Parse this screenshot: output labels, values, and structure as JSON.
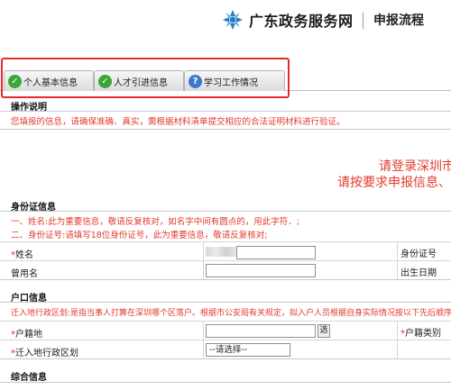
{
  "header": {
    "brand": "广东政务服务网",
    "link": "申报流程"
  },
  "tabs": [
    {
      "label": "个人基本信息",
      "status": "ok"
    },
    {
      "label": "人才引进信息",
      "status": "ok"
    },
    {
      "label": "学习工作情况",
      "status": "question"
    }
  ],
  "instructions": {
    "title": "操作说明",
    "text": "您填报的信息，请确保准确、真实，需根据材料清单提交相应的合法证明材料进行验证。"
  },
  "notice": {
    "line1": "请登录深圳市",
    "line2": "请按要求申报信息、准"
  },
  "id_section": {
    "title": "身份证信息",
    "note1": "一、姓名:此为重要信息，敬请反复核对，如名字中间有圆点的，用此字符．;",
    "note2": "二、身份证号:请填写18位身份证号，此为重要信息，敬请反复核对;",
    "name_label": "姓名",
    "used_name_label": "曾用名",
    "id_no_label": "身份证号",
    "birth_label": "出生日期"
  },
  "hukou_section": {
    "title": "户口信息",
    "note": "迁入地行政区划:是指当事人打算在深圳哪个区落户。根据市公安局有关规定，拟入户人员根据自身实际情况按以下先后顺序依次",
    "domicile_label": "户籍地",
    "select_button": "选",
    "hukou_type_label": "户籍类别",
    "district_label": "迁入地行政区划",
    "district_selected": "--请选择--"
  },
  "next_section": {
    "title": "综合信息"
  }
}
